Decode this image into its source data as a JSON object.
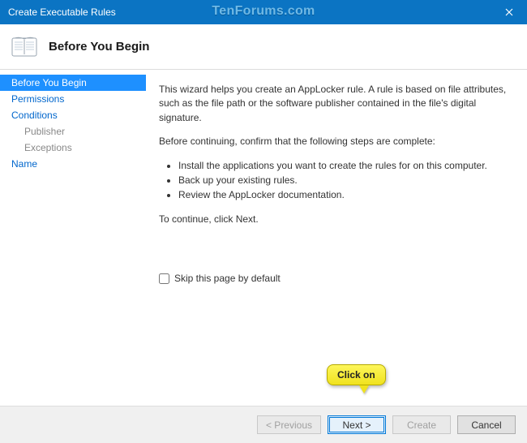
{
  "window": {
    "title": "Create Executable Rules",
    "watermark": "TenForums.com"
  },
  "header": {
    "title": "Before You Begin"
  },
  "sidebar": {
    "items": [
      {
        "label": "Before You Begin",
        "active": true
      },
      {
        "label": "Permissions"
      },
      {
        "label": "Conditions"
      },
      {
        "label": "Publisher",
        "child": true
      },
      {
        "label": "Exceptions",
        "child": true
      },
      {
        "label": "Name"
      }
    ]
  },
  "content": {
    "intro": "This wizard helps you create an AppLocker rule. A rule is based on file attributes, such as the file path or the software publisher contained in the file's digital signature.",
    "confirm": "Before continuing, confirm that the following steps are complete:",
    "steps": [
      "Install the applications you want to create the rules for on this computer.",
      "Back up your existing rules.",
      "Review the AppLocker documentation."
    ],
    "continue": "To continue, click Next.",
    "skip_label": "Skip this page by default"
  },
  "footer": {
    "previous": "< Previous",
    "next": "Next >",
    "create": "Create",
    "cancel": "Cancel"
  },
  "callout": {
    "text": "Click on"
  }
}
